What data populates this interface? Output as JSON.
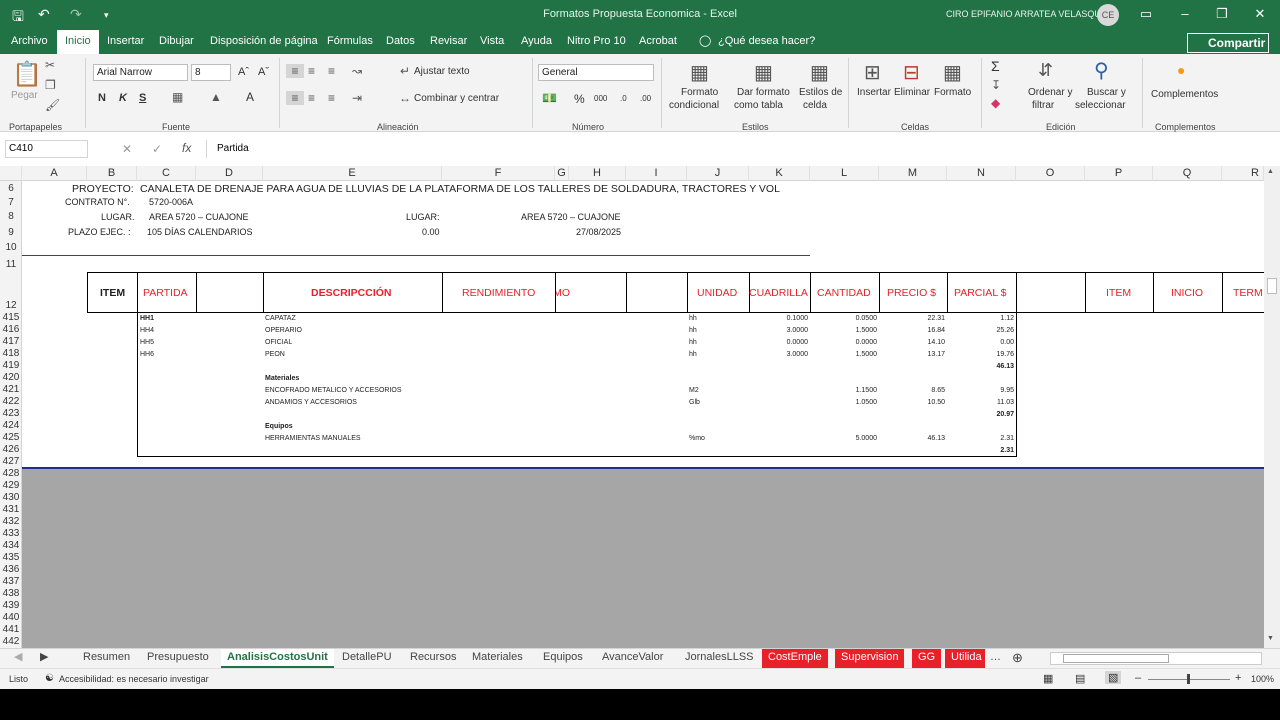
{
  "window": {
    "title": "Formatos Propuesta Economica  -  Excel",
    "user": "CIRO EPIFANIO ARRATEA VELASQUEZ",
    "avatar_initials": "CE"
  },
  "menu": {
    "tabs": [
      "Archivo",
      "Inicio",
      "Insertar",
      "Dibujar",
      "Disposición de página",
      "Fórmulas",
      "Datos",
      "Revisar",
      "Vista",
      "Ayuda",
      "Nitro Pro 10",
      "Acrobat",
      "¿Qué desea hacer?"
    ],
    "active": "Inicio",
    "share_label": "Compartir"
  },
  "ribbon": {
    "paste_label": "Pegar",
    "font_name": "Arial Narrow",
    "font_size": "8",
    "wrap_text": "Ajustar texto",
    "merge_center": "Combinar y centrar",
    "number_format": "General",
    "bold": "N",
    "italic": "K",
    "underline": "S",
    "cond_format": [
      "Formato",
      "condicional"
    ],
    "table_format": [
      "Dar formato",
      "como tabla"
    ],
    "cell_styles": [
      "Estilos de",
      "celda"
    ],
    "insert": "Insertar",
    "delete": "Eliminar",
    "format": "Formato",
    "sort_filter": [
      "Ordenar y",
      "filtrar"
    ],
    "find_select": [
      "Buscar y",
      "seleccionar"
    ],
    "addins": "Complementos",
    "groups": [
      "Portapapeles",
      "Fuente",
      "Alineación",
      "Número",
      "Estilos",
      "Celdas",
      "Edición",
      "Complementos"
    ]
  },
  "formula_bar": {
    "name_box": "C410",
    "formula": "Partida"
  },
  "columns": [
    "A",
    "B",
    "C",
    "D",
    "E",
    "F",
    "G",
    "H",
    "I",
    "J",
    "K",
    "L",
    "M",
    "N",
    "O",
    "P",
    "Q",
    "R"
  ],
  "rows": [
    "6",
    "7",
    "8",
    "9",
    "10",
    "11",
    "12",
    "415",
    "416",
    "417",
    "418",
    "419",
    "420",
    "421",
    "422",
    "423",
    "424",
    "425",
    "426",
    "427",
    "428",
    "429",
    "430",
    "431",
    "432",
    "433",
    "434",
    "435",
    "436",
    "437",
    "438",
    "439",
    "440",
    "441",
    "442"
  ],
  "header_block": {
    "proyecto_label": "PROYECTO:",
    "proyecto_value": "CANALETA DE DRENAJE PARA AGUA DE LLUVIAS DE LA PLATAFORMA DE LOS TALLERES DE SOLDADURA, TRACTORES Y VOL",
    "contrato_label": "CONTRATO N°.",
    "contrato_value": "5720-006A",
    "lugar_label": "LUGAR.",
    "lugar_value": "AREA 5720 – CUAJONE",
    "lugar2_label": "LUGAR:",
    "lugar2_value": "AREA 5720 – CUAJONE",
    "plazo_label": "PLAZO EJEC. :",
    "plazo_value": "105 DÍAS CALENDARIOS",
    "amount": "0.00",
    "date": "27/08/2025"
  },
  "table_headers": {
    "item": "ITEM",
    "partida": "PARTIDA",
    "descripcion": "DESCRIPCCIÓN",
    "rendimiento": "RENDIMIENTO",
    "mo": "MO",
    "unidad": "UNIDAD",
    "cuadrilla": "CUADRILLA",
    "cantidad": "CANTIDAD",
    "precio": "PRECIO $",
    "parcial": "PARCIAL $",
    "item2": "ITEM",
    "inicio": "INICIO",
    "term": "TERM"
  },
  "data_rows": [
    {
      "code": "HH1",
      "desc": "CAPATAZ",
      "unit": "hh",
      "cuadrilla": "0.1000",
      "cantidad": "0.0500",
      "precio": "22.31",
      "parcial": "1.12"
    },
    {
      "code": "HH4",
      "desc": "OPERARIO",
      "unit": "hh",
      "cuadrilla": "3.0000",
      "cantidad": "1.5000",
      "precio": "16.84",
      "parcial": "25.26"
    },
    {
      "code": "HH5",
      "desc": "OFICIAL",
      "unit": "hh",
      "cuadrilla": "0.0000",
      "cantidad": "0.0000",
      "precio": "14.10",
      "parcial": "0.00"
    },
    {
      "code": "HH6",
      "desc": "PEON",
      "unit": "hh",
      "cuadrilla": "3.0000",
      "cantidad": "1.5000",
      "precio": "13.17",
      "parcial": "19.76"
    }
  ],
  "subtotal_mo": "46.13",
  "materiales_label": "Materiales",
  "materiales": [
    {
      "desc": "ENCOFRADO METALICO Y ACCESORIOS",
      "unit": "M2",
      "cantidad": "1.1500",
      "precio": "8.65",
      "parcial": "9.95"
    },
    {
      "desc": "ANDAMIOS Y ACCESORIOS",
      "unit": "Glb",
      "cantidad": "1.0500",
      "precio": "10.50",
      "parcial": "11.03"
    }
  ],
  "subtotal_mat": "20.97",
  "equipos_label": "Equipos",
  "equipos": [
    {
      "desc": "HERRAMIENTAS MANUALES",
      "unit": "%mo",
      "cantidad": "5.0000",
      "precio": "46.13",
      "parcial": "2.31"
    }
  ],
  "subtotal_eq": "2.31",
  "sheet_tabs": [
    {
      "name": "Resumen",
      "type": "normal"
    },
    {
      "name": "Presupuesto",
      "type": "normal"
    },
    {
      "name": "AnalisisCostosUnit",
      "type": "active"
    },
    {
      "name": "DetallePU",
      "type": "normal"
    },
    {
      "name": "Recursos",
      "type": "normal"
    },
    {
      "name": "Materiales",
      "type": "normal"
    },
    {
      "name": "Equipos",
      "type": "normal"
    },
    {
      "name": "AvanceValor",
      "type": "normal"
    },
    {
      "name": "JornalesLLSS",
      "type": "normal"
    },
    {
      "name": "CostEmple",
      "type": "red"
    },
    {
      "name": "Supervision",
      "type": "red"
    },
    {
      "name": "GG",
      "type": "red"
    },
    {
      "name": "Utilida",
      "type": "red"
    }
  ],
  "status_bar": {
    "ready": "Listo",
    "accessibility": "Accesibilidad: es necesario investigar",
    "zoom": "100%"
  },
  "colors": {
    "excel_green": "#217346",
    "header_red": "#e8202a",
    "divider_blue": "#1f2f8f"
  }
}
